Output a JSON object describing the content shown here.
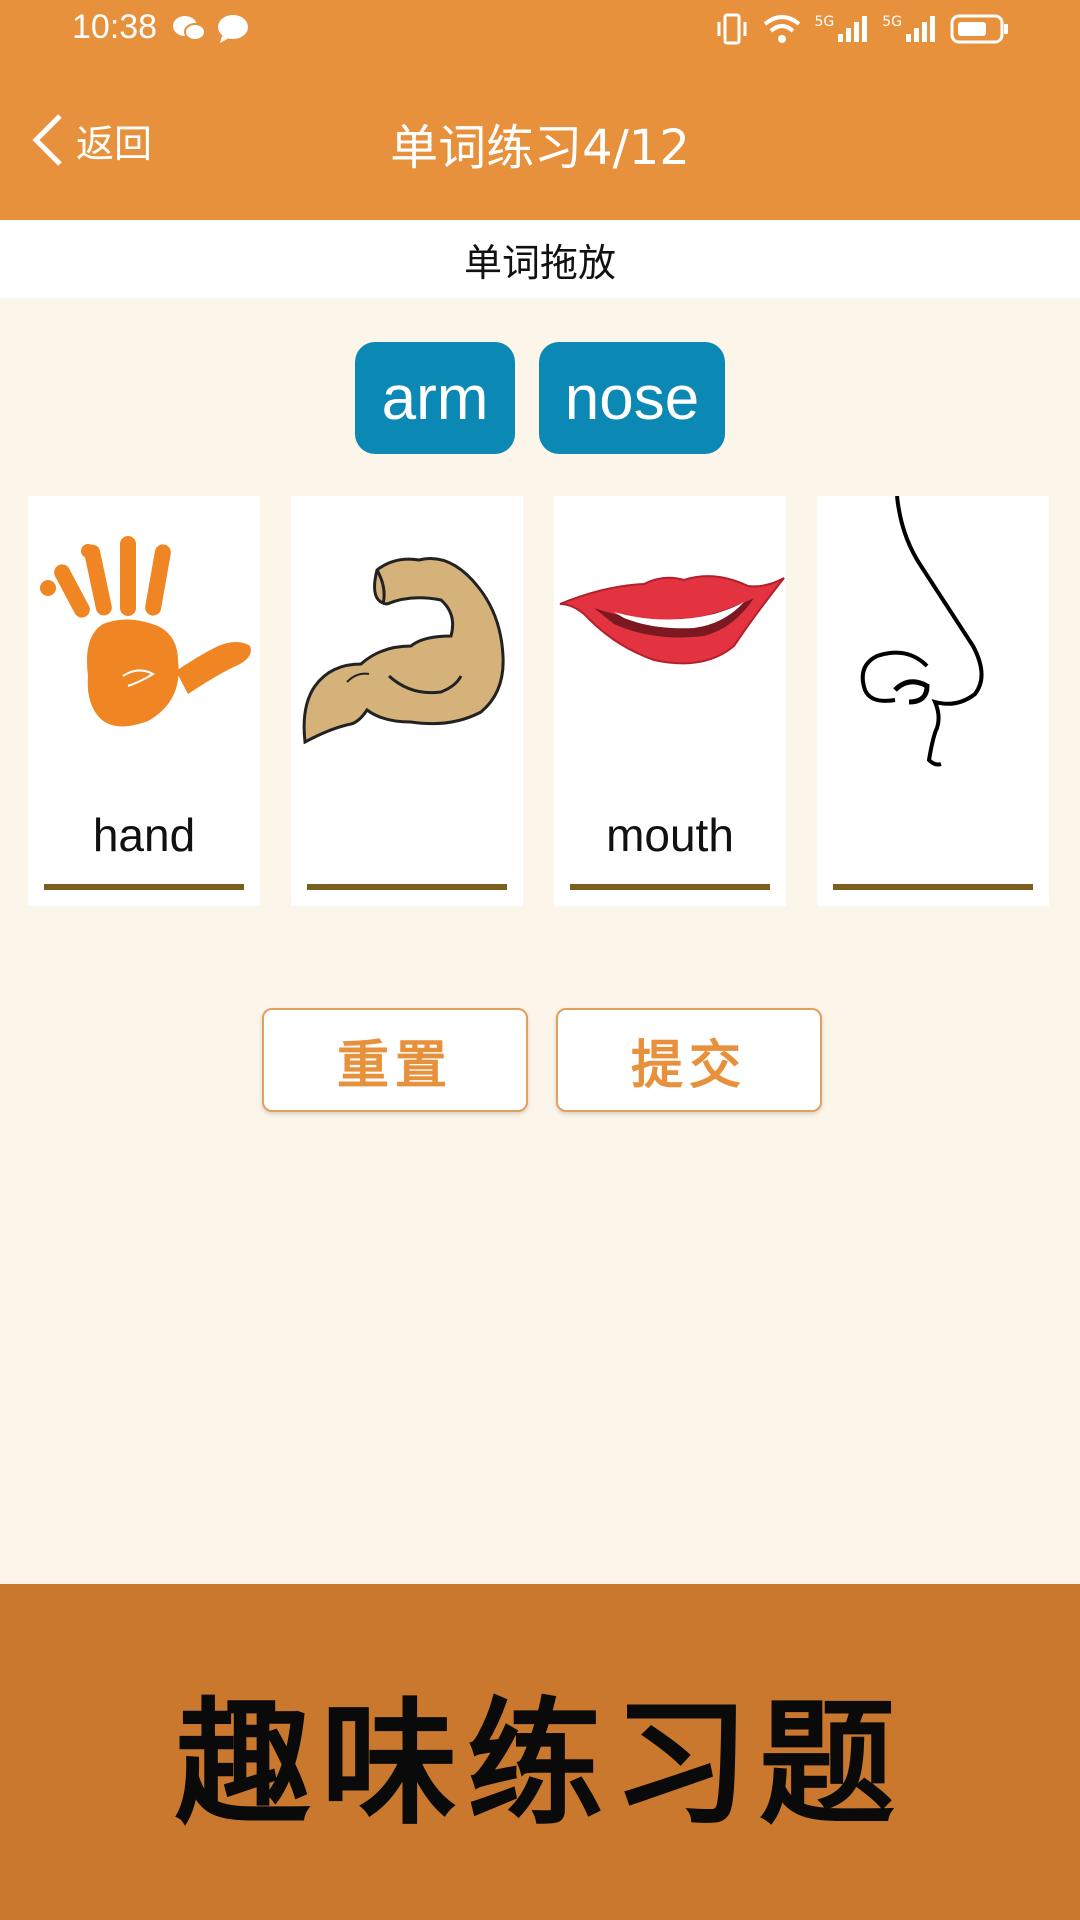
{
  "status_bar": {
    "time": "10:38",
    "network_1": "5G",
    "network_2": "5G"
  },
  "nav": {
    "back_label": "返回",
    "title": "单词练习4/12"
  },
  "exercise": {
    "subtitle": "单词拖放",
    "word_tiles": [
      "arm",
      "nose"
    ],
    "cards": [
      {
        "picture": "hand-icon",
        "word": "hand"
      },
      {
        "picture": "arm-icon",
        "word": ""
      },
      {
        "picture": "mouth-icon",
        "word": "mouth"
      },
      {
        "picture": "nose-icon",
        "word": ""
      }
    ]
  },
  "buttons": {
    "reset_label": "重置",
    "submit_label": "提交"
  },
  "banner": {
    "text": "趣味练习题"
  },
  "colors": {
    "header": "#e8913d",
    "background": "#fbf5ea",
    "tile": "#0b88b4",
    "banner": "#c9782e",
    "underline": "#7b5f1f"
  }
}
